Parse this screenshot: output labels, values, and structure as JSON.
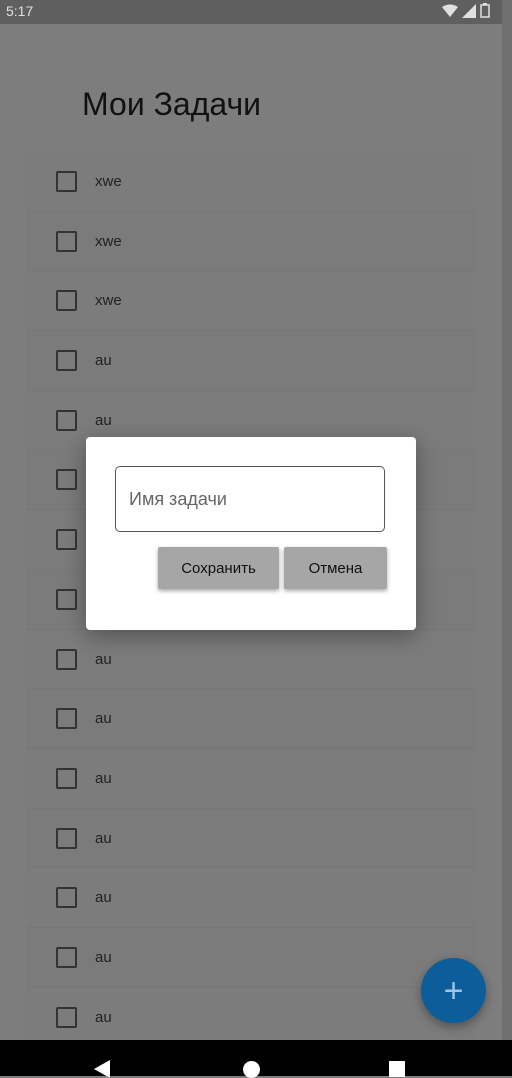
{
  "status_bar": {
    "time": "5:17",
    "icons": [
      "wifi-icon",
      "signal-icon",
      "battery-icon"
    ]
  },
  "app": {
    "title": "Мои Задачи"
  },
  "tasks": [
    {
      "label": "xwe",
      "checked": false
    },
    {
      "label": "xwe",
      "checked": false
    },
    {
      "label": "xwe",
      "checked": false
    },
    {
      "label": "au",
      "checked": false
    },
    {
      "label": "au",
      "checked": false
    },
    {
      "label": "",
      "checked": false
    },
    {
      "label": "",
      "checked": false
    },
    {
      "label": "",
      "checked": false
    },
    {
      "label": "au",
      "checked": false
    },
    {
      "label": "au",
      "checked": false
    },
    {
      "label": "au",
      "checked": false
    },
    {
      "label": "au",
      "checked": false
    },
    {
      "label": "au",
      "checked": false
    },
    {
      "label": "au",
      "checked": false
    },
    {
      "label": "au",
      "checked": false
    }
  ],
  "dialog": {
    "input_placeholder": "Имя задачи",
    "input_value": "",
    "save_label": "Сохранить",
    "cancel_label": "Отмена"
  },
  "fab": {
    "icon": "plus-icon",
    "symbol": "+"
  },
  "nav_bar": {
    "back_icon": "back-icon",
    "home_icon": "home-icon",
    "recents_icon": "recents-icon"
  },
  "colors": {
    "fab": "#0d5d9a",
    "scrim": "#7d7d7d",
    "button": "#a6a6a6"
  }
}
